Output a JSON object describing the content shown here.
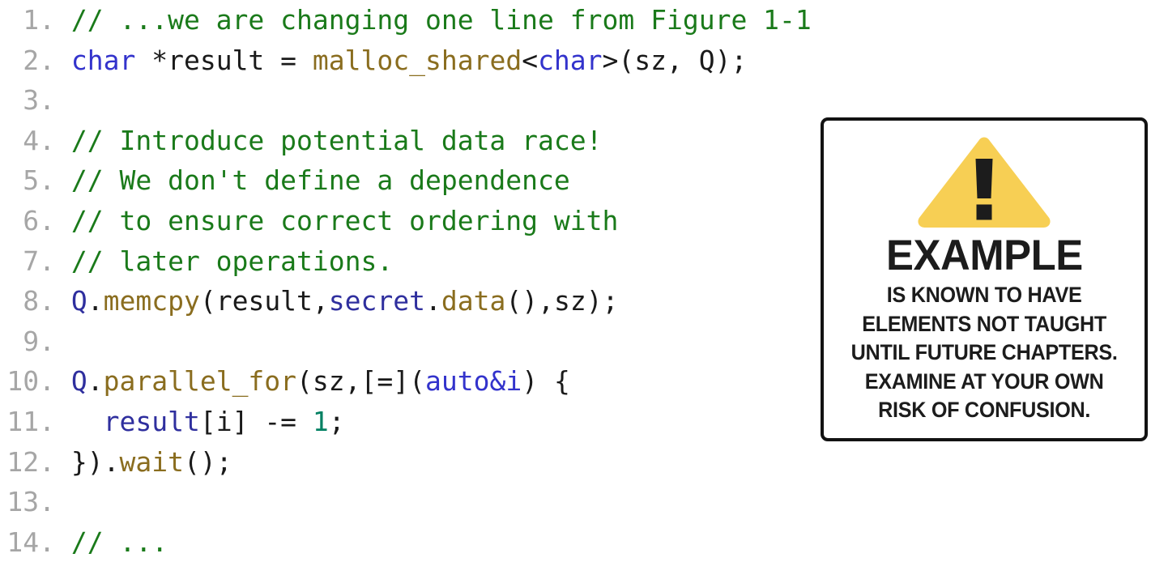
{
  "colors": {
    "background": "#ffffff",
    "line_number": "#a6a6a6",
    "plain": "#1a1a1a",
    "comment": "#1a7a1a",
    "keyword": "#3333cc",
    "function": "#8a6d1f",
    "object": "#2f2f9e",
    "number": "#008062",
    "card_border": "#121212",
    "warning_yellow": "#f7cf54",
    "warning_mark": "#1c1c1c"
  },
  "code_listing": {
    "language": "cpp",
    "first_line_number": 1,
    "lines": [
      {
        "number": "1.",
        "text": "// ...we are changing one line from Figure 1-1",
        "tokens": [
          {
            "text": "// ...we are changing one line from Figure 1-1",
            "type": "comment"
          }
        ]
      },
      {
        "number": "2.",
        "text": "char *result = malloc_shared<char>(sz, Q);",
        "tokens": [
          {
            "text": "char",
            "type": "key"
          },
          {
            "text": " *result = ",
            "type": "plain"
          },
          {
            "text": "malloc_shared",
            "type": "func"
          },
          {
            "text": "<",
            "type": "plain"
          },
          {
            "text": "char",
            "type": "key"
          },
          {
            "text": ">(sz, Q);",
            "type": "plain"
          }
        ]
      },
      {
        "number": "3.",
        "text": "",
        "tokens": []
      },
      {
        "number": "4.",
        "text": "// Introduce potential data race!",
        "tokens": [
          {
            "text": "// Introduce potential data race!",
            "type": "comment"
          }
        ]
      },
      {
        "number": "5.",
        "text": "// We don't define a dependence",
        "tokens": [
          {
            "text": "// We don't define a dependence",
            "type": "comment"
          }
        ]
      },
      {
        "number": "6.",
        "text": "// to ensure correct ordering with",
        "tokens": [
          {
            "text": "// to ensure correct ordering with",
            "type": "comment"
          }
        ]
      },
      {
        "number": "7.",
        "text": "// later operations.",
        "tokens": [
          {
            "text": "// later operations.",
            "type": "comment"
          }
        ]
      },
      {
        "number": "8.",
        "text": "Q.memcpy(result,secret.data(),sz);",
        "tokens": [
          {
            "text": "Q",
            "type": "obj"
          },
          {
            "text": ".",
            "type": "plain"
          },
          {
            "text": "memcpy",
            "type": "func"
          },
          {
            "text": "(result,",
            "type": "plain"
          },
          {
            "text": "secret",
            "type": "obj"
          },
          {
            "text": ".",
            "type": "plain"
          },
          {
            "text": "data",
            "type": "func"
          },
          {
            "text": "(),sz);",
            "type": "plain"
          }
        ]
      },
      {
        "number": "9.",
        "text": "",
        "tokens": []
      },
      {
        "number": "10.",
        "text": "Q.parallel_for(sz,[=](auto&i) {",
        "tokens": [
          {
            "text": "Q",
            "type": "obj"
          },
          {
            "text": ".",
            "type": "plain"
          },
          {
            "text": "parallel_for",
            "type": "func"
          },
          {
            "text": "(sz,[=](",
            "type": "plain"
          },
          {
            "text": "auto&i",
            "type": "key"
          },
          {
            "text": ") {",
            "type": "plain"
          }
        ]
      },
      {
        "number": "11.",
        "text": "  result[i] -= 1;",
        "tokens": [
          {
            "text": "  ",
            "type": "plain"
          },
          {
            "text": "result",
            "type": "obj"
          },
          {
            "text": "[i] -= ",
            "type": "plain"
          },
          {
            "text": "1",
            "type": "num"
          },
          {
            "text": ";",
            "type": "plain"
          }
        ]
      },
      {
        "number": "12.",
        "text": "}).wait();",
        "tokens": [
          {
            "text": "}).",
            "type": "plain"
          },
          {
            "text": "wait",
            "type": "func"
          },
          {
            "text": "();",
            "type": "plain"
          }
        ]
      },
      {
        "number": "13.",
        "text": "",
        "tokens": []
      },
      {
        "number": "14.",
        "text": "// ...",
        "tokens": [
          {
            "text": "// ...",
            "type": "comment"
          }
        ]
      }
    ]
  },
  "example_card": {
    "icon": "warning-triangle-icon",
    "title": "EXAMPLE",
    "body_lines": [
      "IS KNOWN TO HAVE",
      "ELEMENTS NOT TAUGHT",
      "UNTIL FUTURE CHAPTERS.",
      "EXAMINE AT YOUR OWN",
      "RISK OF CONFUSION."
    ]
  }
}
